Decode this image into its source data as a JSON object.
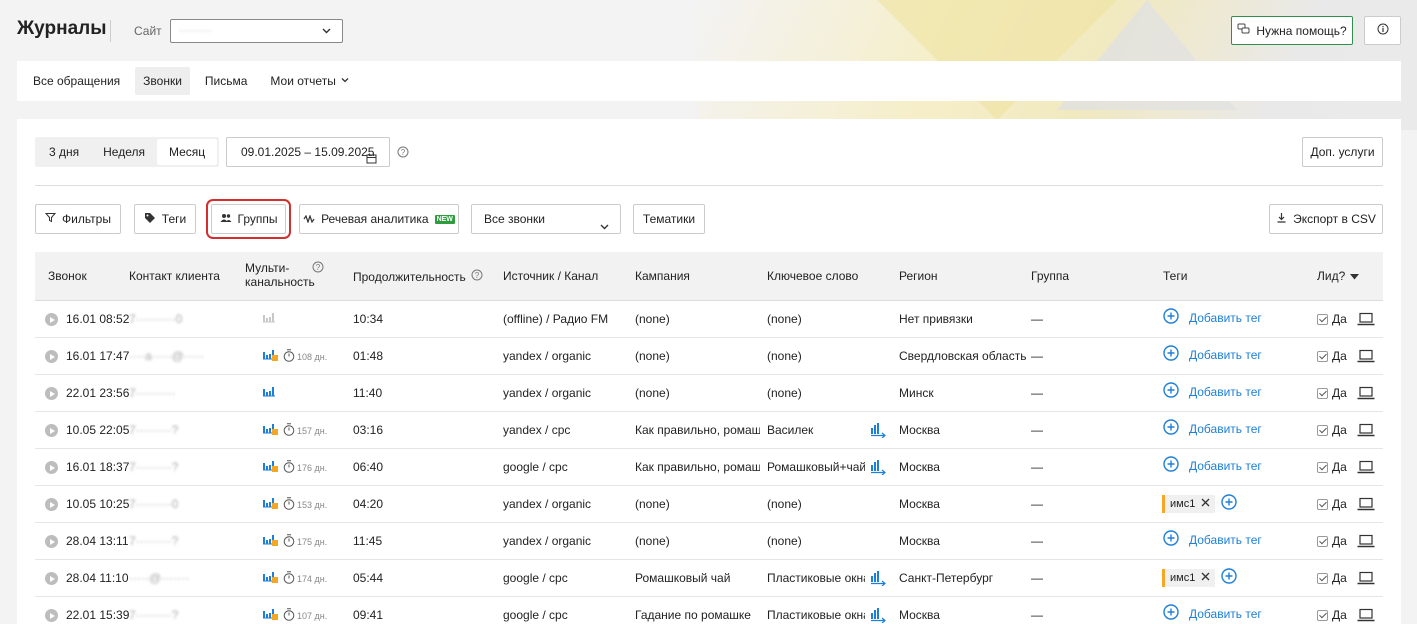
{
  "header": {
    "title": "Журналы",
    "site_label": "Сайт",
    "site_value": "·········",
    "help_label": "Нужна помощь?"
  },
  "tabs": [
    {
      "label": "Все обращения",
      "active": false
    },
    {
      "label": "Звонки",
      "active": true
    },
    {
      "label": "Письма",
      "active": false
    },
    {
      "label": "Мои отчеты",
      "active": false
    }
  ],
  "period": {
    "options": [
      "3 дня",
      "Неделя",
      "Месяц"
    ],
    "selected": "Месяц",
    "date_range": "09.01.2025 – 15.09.2025"
  },
  "extra_services_label": "Доп. услуги",
  "filters": {
    "filters_label": "Фильтры",
    "tags_label": "Теги",
    "groups_label": "Группы",
    "speech_label": "Речевая аналитика",
    "new_badge": "NEW",
    "calls_select": "Все звонки",
    "topics_label": "Тематики",
    "export_label": "Экспорт в CSV"
  },
  "table": {
    "columns": {
      "call": "Звонок",
      "contact": "Контакт клиента",
      "multi1": "Мульти-",
      "multi2": "канальность",
      "duration": "Продолжительность",
      "source": "Источник / Канал",
      "campaign": "Кампания",
      "keyword": "Ключевое слово",
      "region": "Регион",
      "group": "Группа",
      "tags": "Теги",
      "lead": "Лид?"
    },
    "add_tag_label": "Добавить тег",
    "lead_yes": "Да",
    "rows": [
      {
        "time": "16.01 08:52",
        "contact": "7··········0",
        "multi": "gray",
        "days": "",
        "duration": "10:34",
        "source": "(offline) / Радио FM",
        "campaign": "(none)",
        "keyword": "(none)",
        "kwicon": false,
        "region": "Нет привязки",
        "group": "—",
        "tag": ""
      },
      {
        "time": "16.01 17:47",
        "contact": "····a·····@·····",
        "multi": "orange",
        "days": "108 дн.",
        "duration": "01:48",
        "source": "yandex / organic",
        "campaign": "(none)",
        "keyword": "(none)",
        "kwicon": false,
        "region": "Свердловская область",
        "group": "—",
        "tag": ""
      },
      {
        "time": "22.01 23:56",
        "contact": "7··········",
        "multi": "blue",
        "days": "",
        "duration": "11:40",
        "source": "yandex / organic",
        "campaign": "(none)",
        "keyword": "(none)",
        "kwicon": false,
        "region": "Минск",
        "group": "—",
        "tag": ""
      },
      {
        "time": "10.05 22:05",
        "contact": "7·········?",
        "multi": "orange",
        "days": "157 дн.",
        "duration": "03:16",
        "source": "yandex / cpc",
        "campaign": "Как правильно, ромаш...",
        "keyword": "Василек",
        "kwicon": true,
        "region": "Москва",
        "group": "—",
        "tag": ""
      },
      {
        "time": "16.01 18:37",
        "contact": "7·········?",
        "multi": "orange",
        "days": "176 дн.",
        "duration": "06:40",
        "source": "google / cpc",
        "campaign": "Как правильно, ромаш...",
        "keyword": "Ромашковый+чай",
        "kwicon": true,
        "region": "Москва",
        "group": "—",
        "tag": ""
      },
      {
        "time": "10.05 10:25",
        "contact": "7·········0",
        "multi": "orange",
        "days": "153 дн.",
        "duration": "04:20",
        "source": "yandex / organic",
        "campaign": "(none)",
        "keyword": "(none)",
        "kwicon": false,
        "region": "Москва",
        "group": "—",
        "tag": "имс1"
      },
      {
        "time": "28.04 13:11",
        "contact": "7·········?",
        "multi": "orange",
        "days": "175 дн.",
        "duration": "11:45",
        "source": "yandex / organic",
        "campaign": "(none)",
        "keyword": "(none)",
        "kwicon": false,
        "region": "Москва",
        "group": "—",
        "tag": ""
      },
      {
        "time": "28.04 11:10",
        "contact": "·····@·······",
        "multi": "orange",
        "days": "174 дн.",
        "duration": "05:44",
        "source": "google / cpc",
        "campaign": "Ромашковый чай",
        "keyword": "Пластиковые окна",
        "kwicon": true,
        "region": "Санкт-Петербург",
        "group": "—",
        "tag": "имс1"
      },
      {
        "time": "22.01 15:39",
        "contact": "7·········?",
        "multi": "orange",
        "days": "107 дн.",
        "duration": "09:41",
        "source": "google / cpc",
        "campaign": "Гадание по ромашке",
        "keyword": "Пластиковые окна",
        "kwicon": true,
        "region": "Москва",
        "group": "—",
        "tag": ""
      }
    ]
  },
  "colors": {
    "accent": "#1e7fd6",
    "help_border": "#2f8f4e",
    "highlight": "#d32f2f",
    "badge": "#f5a623",
    "new_badge": "#2e9d3e"
  }
}
